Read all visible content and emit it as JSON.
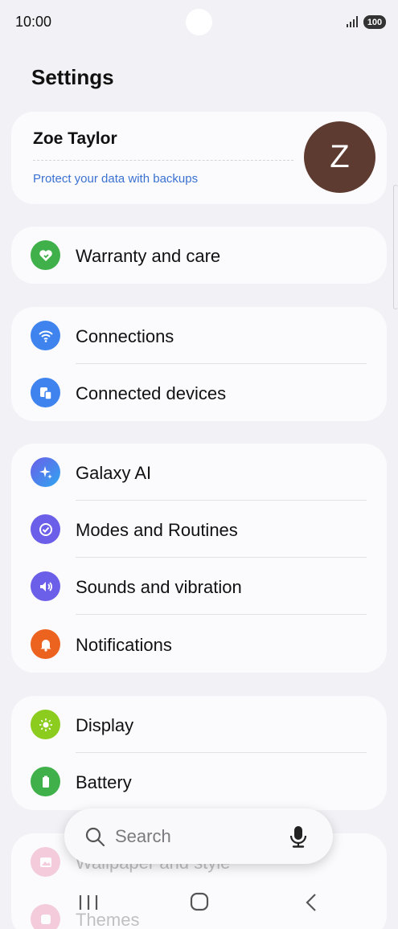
{
  "status_bar": {
    "time": "10:00",
    "battery": "100"
  },
  "header": {
    "title": "Settings"
  },
  "account": {
    "name": "Zoe Taylor",
    "subtitle": "Protect your data with backups",
    "avatar_letter": "Z",
    "avatar_color": "#5e3b30"
  },
  "groups": {
    "warranty": {
      "label": "Warranty and care",
      "icon": "heart-icon",
      "color": "#3fb04a"
    },
    "connections": [
      {
        "label": "Connections",
        "icon": "wifi-icon",
        "color": "#3f83ef"
      },
      {
        "label": "Connected devices",
        "icon": "devices-icon",
        "color": "#3f83ef"
      }
    ],
    "features": [
      {
        "label": "Galaxy AI",
        "icon": "sparkle-icon",
        "color": "#4a6cf0"
      },
      {
        "label": "Modes and Routines",
        "icon": "routine-check-icon",
        "color": "#6b5ee8"
      },
      {
        "label": "Sounds and vibration",
        "icon": "speaker-icon",
        "color": "#6b5ee8"
      },
      {
        "label": "Notifications",
        "icon": "bell-icon",
        "color": "#ec6320"
      }
    ],
    "display": [
      {
        "label": "Display",
        "icon": "sun-icon",
        "color": "#8ccc1f"
      },
      {
        "label": "Battery",
        "icon": "battery-icon",
        "color": "#3fb04a"
      }
    ],
    "personalize": [
      {
        "label": "Wallpaper and style",
        "icon": "image-icon",
        "color": "#e0407a"
      },
      {
        "label": "Themes",
        "icon": "themes-icon",
        "color": "#e0407a"
      }
    ]
  },
  "search": {
    "placeholder": "Search"
  },
  "nav": {
    "recent": "recent-apps-icon",
    "home": "home-icon",
    "back": "back-icon"
  }
}
